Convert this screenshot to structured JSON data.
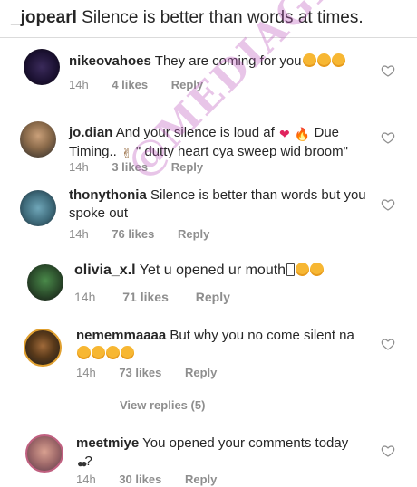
{
  "caption": {
    "username": "_jopearl",
    "text": "Silence is better than words at times."
  },
  "watermark": "@MEDIAGIST",
  "colors": {
    "text": "#262626",
    "meta": "#8e8e8e",
    "divider": "#dbdbdb",
    "watermark": "#be5abe"
  },
  "comments": [
    {
      "username": "nikeovahoes",
      "text": "They are coming for you",
      "emojis": [
        "face-emoji",
        "face-emoji",
        "face-emoji"
      ],
      "time": "14h",
      "likes": "4 likes",
      "reply": "Reply"
    },
    {
      "username": "jo.dian",
      "text": "And your silence is loud af",
      "text2": "Due Timing..",
      "text3": "\" dutty heart cya sweep wid broom\"",
      "emojis": [
        "heart-emoji",
        "fire-emoji",
        "hand-emoji"
      ],
      "time": "14h",
      "likes": "3 likes",
      "reply": "Reply"
    },
    {
      "username": "thonythonia",
      "text": "Silence  is better than words but you spoke out",
      "time": "14h",
      "likes": "76 likes",
      "reply": "Reply"
    },
    {
      "username": "olivia_x.l",
      "text": "Yet u opened ur mouth",
      "emojis": [
        "box-emoji",
        "face-emoji",
        "face-emoji"
      ],
      "time": "14h",
      "likes": "71 likes",
      "reply": "Reply"
    },
    {
      "username": "nememmaaaa",
      "text": "But why you no come silent na",
      "emojis": [
        "face-emoji",
        "face-emoji",
        "face-emoji",
        "face-emoji"
      ],
      "time": "14h",
      "likes": "73 likes",
      "reply": "Reply"
    },
    {
      "username": "meetmiye",
      "text": "You opened your comments today",
      "text2": "?",
      "emojis": [
        "eyes-emoji"
      ],
      "time": "14h",
      "likes": "30 likes",
      "reply": "Reply"
    }
  ],
  "view_replies": "View replies (5)"
}
